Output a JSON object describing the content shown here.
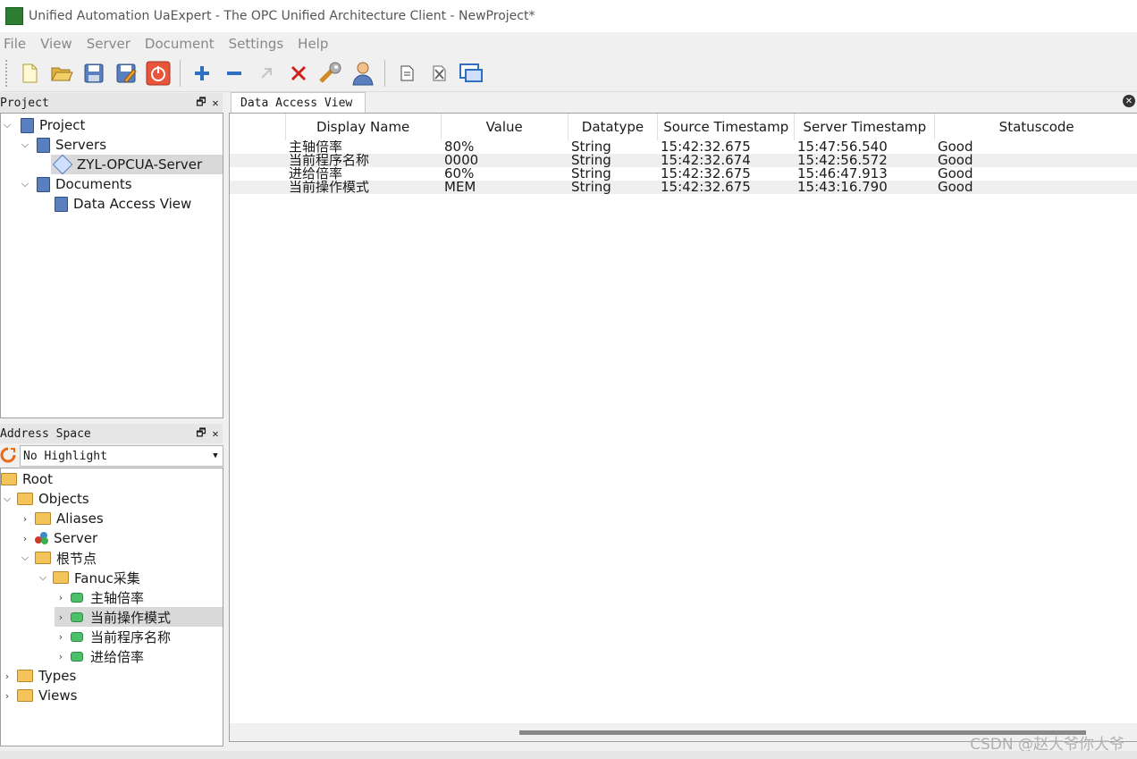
{
  "window": {
    "title": "Unified Automation UaExpert - The OPC Unified Architecture Client - NewProject*"
  },
  "menu": [
    "File",
    "View",
    "Server",
    "Document",
    "Settings",
    "Help"
  ],
  "toolbar": {
    "buttons": [
      "new-project-icon",
      "open-project-icon",
      "save-project-icon",
      "save-as-icon",
      "quit-icon",
      "add-server-icon",
      "remove-server-icon",
      "connect-server-icon",
      "disconnect-server-icon",
      "settings-wrench-icon",
      "user-icon",
      "add-document-icon",
      "remove-document-icon",
      "window-view-icon"
    ]
  },
  "project_panel": {
    "title": "Project",
    "tree": [
      {
        "label": "Project",
        "level": 0,
        "icon": "book",
        "expanded": true
      },
      {
        "label": "Servers",
        "level": 1,
        "icon": "book",
        "expanded": true
      },
      {
        "label": "ZYL-OPCUA-Server",
        "level": 2,
        "icon": "server",
        "selected": true
      },
      {
        "label": "Documents",
        "level": 1,
        "icon": "book",
        "expanded": true
      },
      {
        "label": "Data Access View",
        "level": 2,
        "icon": "book"
      }
    ]
  },
  "address_panel": {
    "title": "Address Space",
    "highlight": "No Highlight",
    "tree": [
      {
        "label": "Root",
        "level": 0,
        "icon": "folder",
        "expanded": true
      },
      {
        "label": "Objects",
        "level": 0,
        "icon": "folder",
        "expanded": true
      },
      {
        "label": "Aliases",
        "level": 1,
        "icon": "folder",
        "expanded": false
      },
      {
        "label": "Server",
        "level": 1,
        "icon": "server",
        "expanded": false
      },
      {
        "label": "根节点",
        "level": 1,
        "icon": "folder",
        "expanded": true
      },
      {
        "label": "Fanuc采集",
        "level": 2,
        "icon": "folder",
        "expanded": true
      },
      {
        "label": "主轴倍率",
        "level": 3,
        "icon": "var",
        "expanded": false
      },
      {
        "label": "当前操作模式",
        "level": 3,
        "icon": "var",
        "expanded": false,
        "selected": true
      },
      {
        "label": "当前程序名称",
        "level": 3,
        "icon": "var",
        "expanded": false
      },
      {
        "label": "进给倍率",
        "level": 3,
        "icon": "var",
        "expanded": false
      },
      {
        "label": "Types",
        "level": 0,
        "icon": "folder",
        "expanded": false
      },
      {
        "label": "Views",
        "level": 0,
        "icon": "folder",
        "expanded": false
      }
    ]
  },
  "data_view": {
    "tab_label": "Data Access View",
    "columns": [
      "",
      "Display Name",
      "Value",
      "Datatype",
      "Source Timestamp",
      "Server Timestamp",
      "Statuscode"
    ],
    "rows": [
      [
        "",
        "主轴倍率",
        "80%",
        "String",
        "15:42:32.675",
        "15:47:56.540",
        "Good"
      ],
      [
        "",
        "当前程序名称",
        "0000",
        "String",
        "15:42:32.674",
        "15:42:56.572",
        "Good"
      ],
      [
        "",
        "进给倍率",
        "60%",
        "String",
        "15:42:32.675",
        "15:46:47.913",
        "Good"
      ],
      [
        "",
        "当前操作模式",
        "MEM",
        "String",
        "15:42:32.675",
        "15:43:16.790",
        "Good"
      ]
    ]
  },
  "watermark": "CSDN @赵大爷你大爷"
}
